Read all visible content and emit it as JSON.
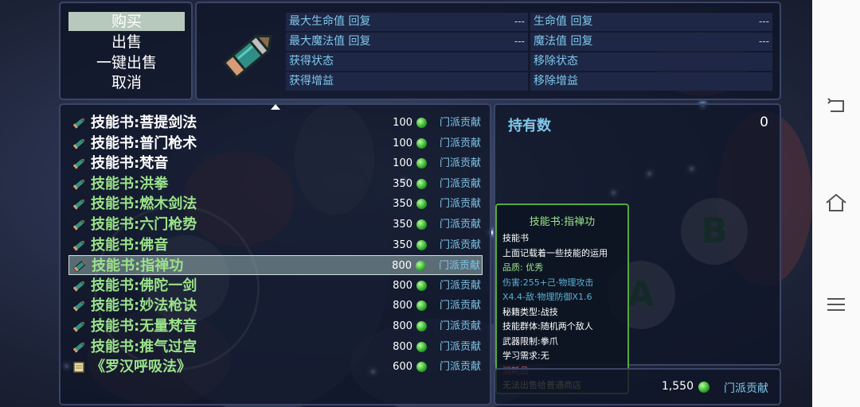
{
  "commands": [
    {
      "label": "购买",
      "selected": true
    },
    {
      "label": "出售",
      "selected": false
    },
    {
      "label": "一键出售",
      "selected": false
    },
    {
      "label": "取消",
      "selected": false
    }
  ],
  "effects": [
    {
      "label": "最大生命值 回复",
      "value": "---"
    },
    {
      "label": "生命值 回复",
      "value": "---"
    },
    {
      "label": "最大魔法值 回复",
      "value": "---"
    },
    {
      "label": "魔法值 回复",
      "value": "---"
    },
    {
      "label": "获得状态",
      "value": ""
    },
    {
      "label": "移除状态",
      "value": ""
    },
    {
      "label": "获得增益",
      "value": ""
    },
    {
      "label": "移除增益",
      "value": ""
    }
  ],
  "items": [
    {
      "name": "技能书:菩提剑法",
      "price": "100",
      "currency": "门派贡献",
      "color": "white",
      "icon": "pencil-book-icon"
    },
    {
      "name": "技能书:普门枪术",
      "price": "100",
      "currency": "门派贡献",
      "color": "white",
      "icon": "pencil-book-icon"
    },
    {
      "name": "技能书:梵音",
      "price": "100",
      "currency": "门派贡献",
      "color": "white",
      "icon": "pencil-book-icon"
    },
    {
      "name": "技能书:洪拳",
      "price": "350",
      "currency": "门派贡献",
      "color": "green",
      "icon": "pencil-book-icon"
    },
    {
      "name": "技能书:燃木剑法",
      "price": "350",
      "currency": "门派贡献",
      "color": "green",
      "icon": "pencil-book-icon"
    },
    {
      "name": "技能书:六门枪势",
      "price": "350",
      "currency": "门派贡献",
      "color": "green",
      "icon": "pencil-book-icon"
    },
    {
      "name": "技能书:佛音",
      "price": "350",
      "currency": "门派贡献",
      "color": "green",
      "icon": "pencil-book-icon"
    },
    {
      "name": "技能书:指禅功",
      "price": "800",
      "currency": "门派贡献",
      "color": "green",
      "icon": "pencil-book-icon",
      "selected": true
    },
    {
      "name": "技能书:佛陀一剑",
      "price": "800",
      "currency": "门派贡献",
      "color": "green",
      "icon": "pencil-book-icon"
    },
    {
      "name": "技能书:妙法枪诀",
      "price": "800",
      "currency": "门派贡献",
      "color": "green",
      "icon": "pencil-book-icon"
    },
    {
      "name": "技能书:无量梵音",
      "price": "800",
      "currency": "门派贡献",
      "color": "green",
      "icon": "pencil-book-icon"
    },
    {
      "name": "技能书:推气过宫",
      "price": "800",
      "currency": "门派贡献",
      "color": "green",
      "icon": "pencil-book-icon"
    },
    {
      "name": "《罗汉呼吸法》",
      "price": "600",
      "currency": "门派贡献",
      "color": "green",
      "icon": "scroll-icon"
    }
  ],
  "possession": {
    "label": "持有数",
    "count": "0"
  },
  "help": {
    "title": "技能书:指禅功",
    "lines": [
      {
        "text": "技能书",
        "color": "white"
      },
      {
        "text": "上面记载着一些技能的运用",
        "color": "white"
      },
      {
        "text": "品质: 优秀",
        "color": "green"
      },
      {
        "text": "伤害:255+己·物理攻击",
        "color": "blue"
      },
      {
        "text": "X4.4-敌·物理防御X1.6",
        "color": "blue"
      },
      {
        "text": "秘籍类型:战技",
        "color": "white"
      },
      {
        "text": "技能群体:随机两个敌人",
        "color": "white"
      },
      {
        "text": "武器限制:拳爪",
        "color": "white"
      },
      {
        "text": "学习需求:无",
        "color": "white"
      },
      {
        "text": "消耗品",
        "color": "red"
      },
      {
        "text": "无法出售给普通商店",
        "color": "yellow"
      }
    ]
  },
  "gold": {
    "value": "1,550",
    "currency": "门派贡献"
  },
  "buttons": {
    "a": "A",
    "b": "B"
  },
  "nav": {
    "back": "back-icon",
    "home": "home-icon",
    "menu": "menu-icon"
  }
}
